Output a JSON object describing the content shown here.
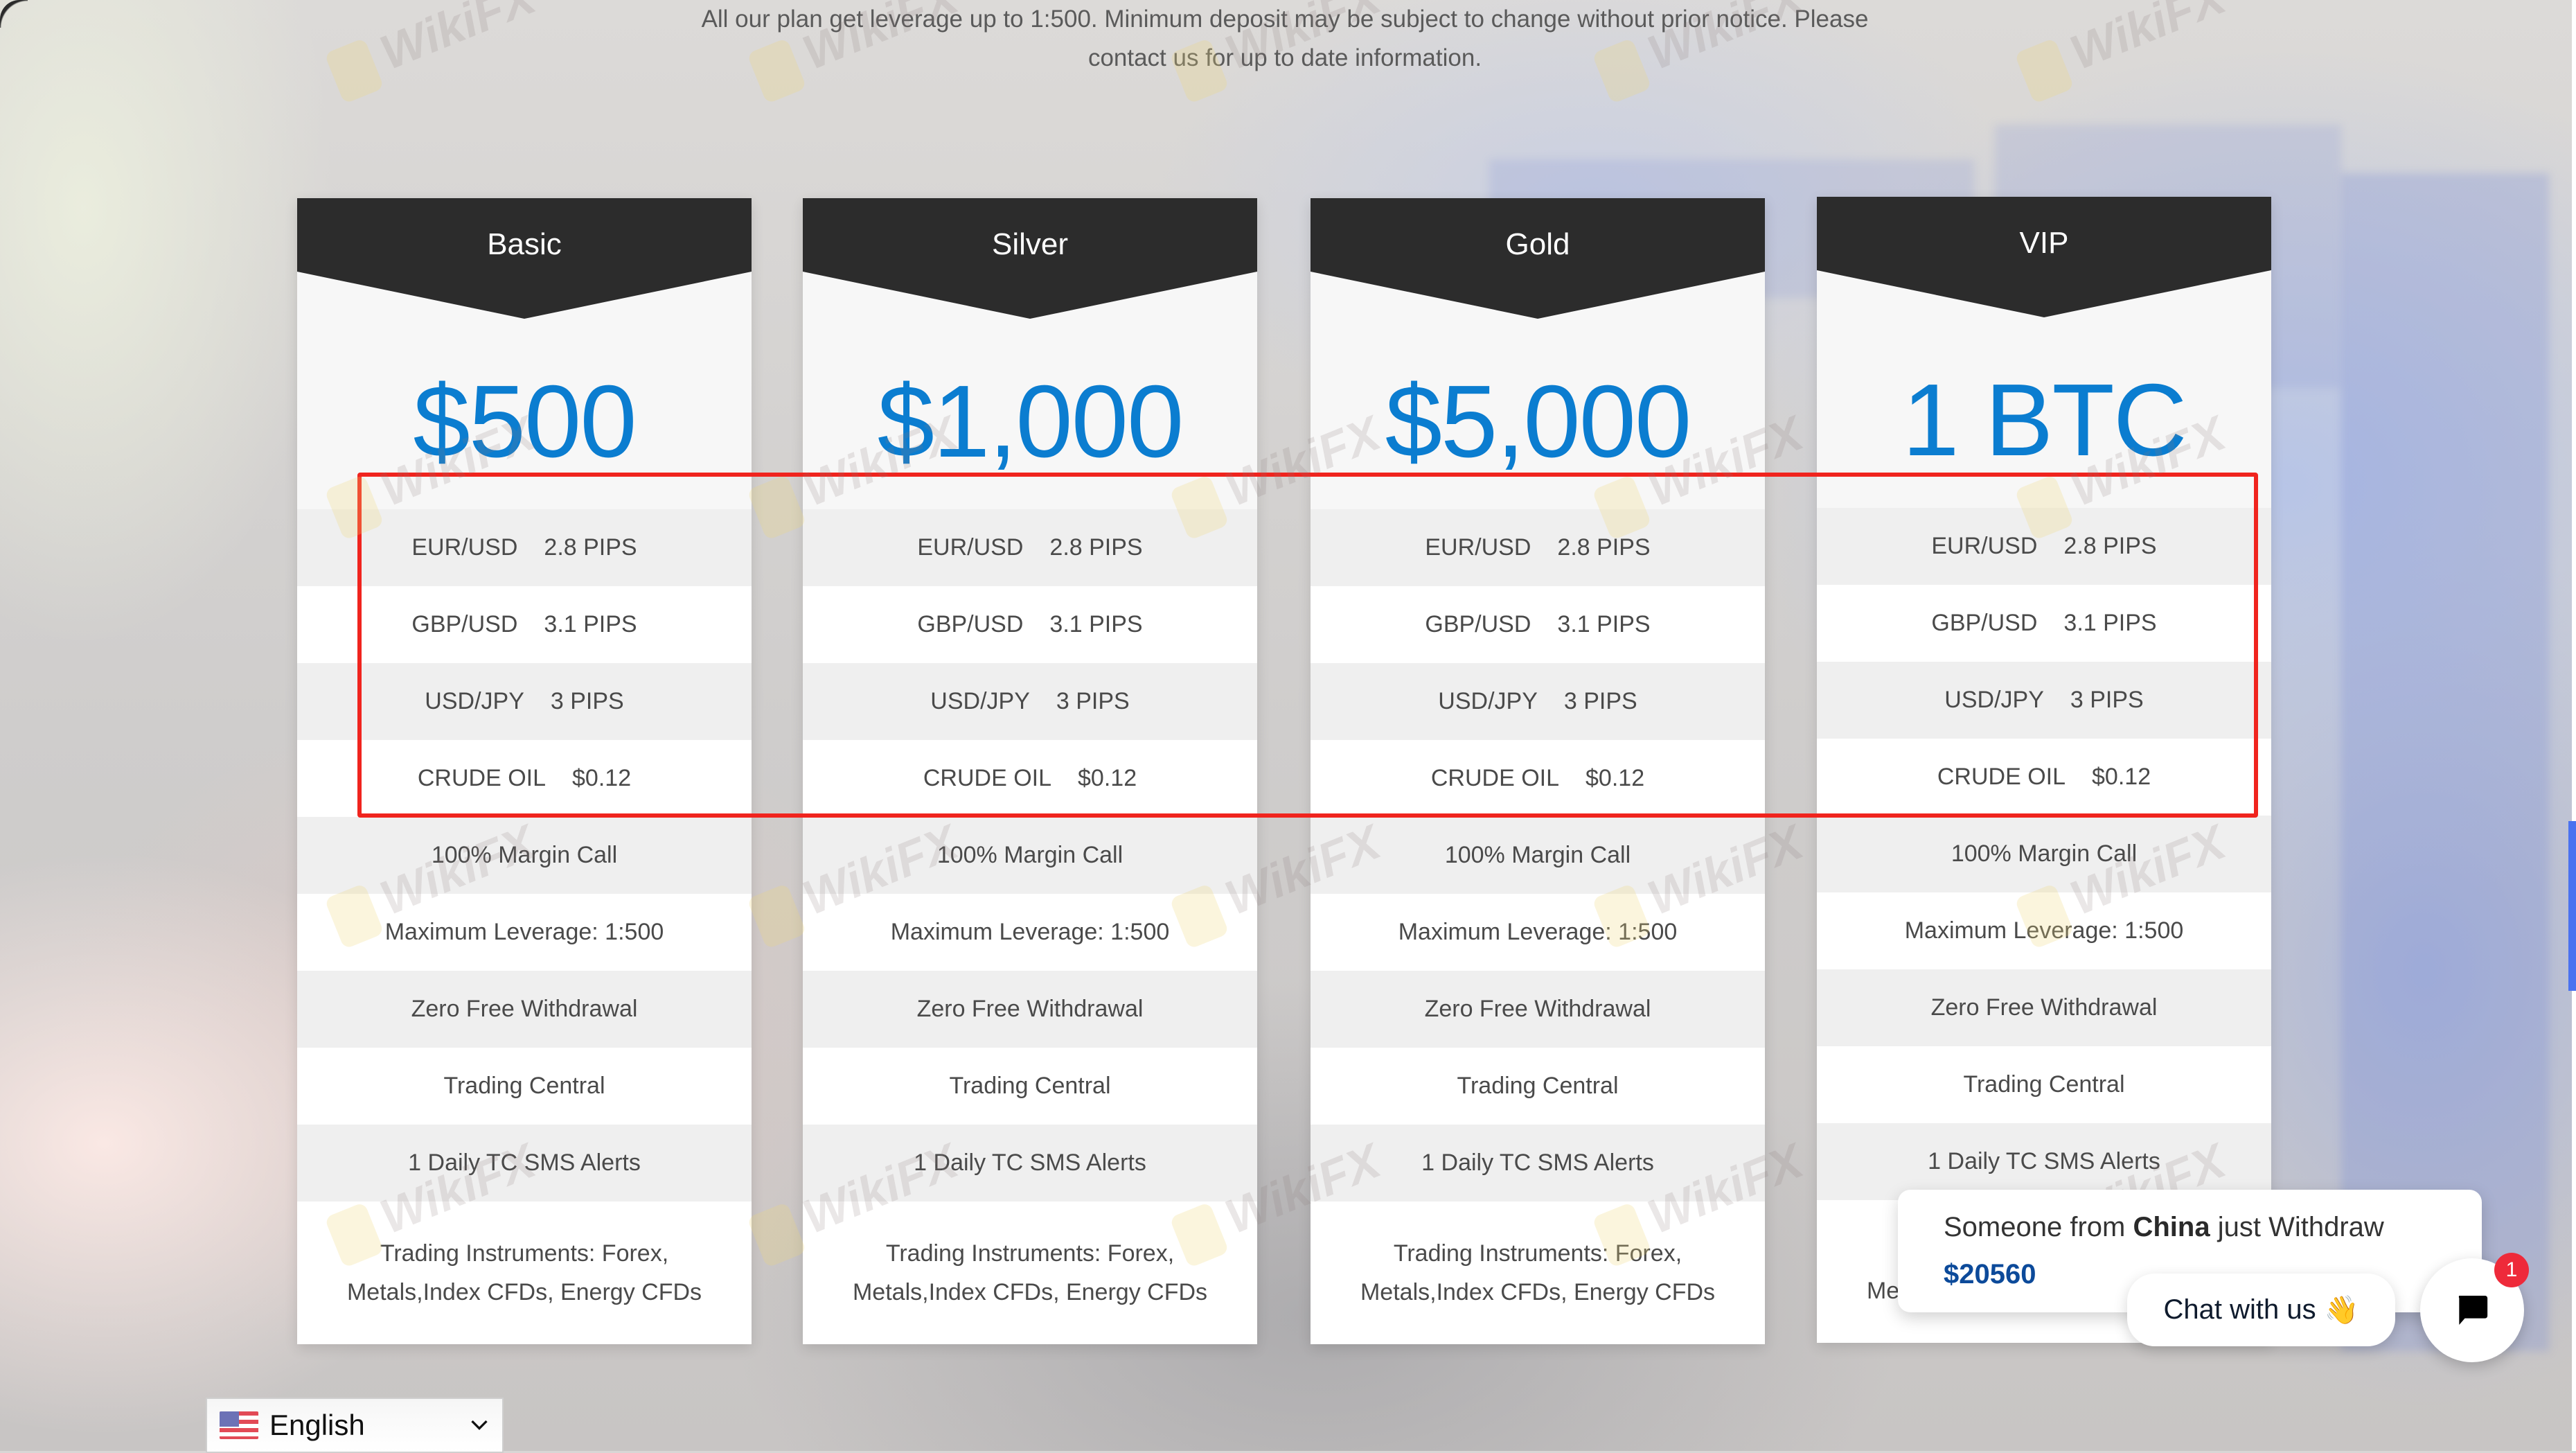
{
  "notice": {
    "line1": "All our plan get leverage up to 1:500. Minimum deposit may be subject to change without prior notice. Please",
    "line2": "contact us for up to date information."
  },
  "colors": {
    "header_dark": "#2c2c2c",
    "price_blue": "#0b7dd0",
    "highlight_red": "#f0241e",
    "scroll_accent": "#4a72f0",
    "badge_red": "#ee2a3a",
    "amount_blue": "#0c4a9a"
  },
  "plans": [
    {
      "name": "Basic",
      "price": "$500",
      "spreads": [
        {
          "pair": "EUR/USD",
          "value": "2.8 PIPS"
        },
        {
          "pair": "GBP/USD",
          "value": "3.1 PIPS"
        },
        {
          "pair": "USD/JPY",
          "value": "3 PIPS"
        },
        {
          "pair": "CRUDE OIL",
          "value": "$0.12"
        }
      ],
      "features": [
        "100% Margin Call",
        "Maximum Leverage: 1:500",
        "Zero Free Withdrawal",
        "Trading Central",
        "1 Daily TC SMS Alerts"
      ],
      "instruments": "Trading Instruments: Forex, Metals,Index CFDs, Energy CFDs"
    },
    {
      "name": "Silver",
      "price": "$1,000",
      "spreads": [
        {
          "pair": "EUR/USD",
          "value": "2.8 PIPS"
        },
        {
          "pair": "GBP/USD",
          "value": "3.1 PIPS"
        },
        {
          "pair": "USD/JPY",
          "value": "3 PIPS"
        },
        {
          "pair": "CRUDE OIL",
          "value": "$0.12"
        }
      ],
      "features": [
        "100% Margin Call",
        "Maximum Leverage: 1:500",
        "Zero Free Withdrawal",
        "Trading Central",
        "1 Daily TC SMS Alerts"
      ],
      "instruments": "Trading Instruments: Forex, Metals,Index CFDs, Energy CFDs"
    },
    {
      "name": "Gold",
      "price": "$5,000",
      "spreads": [
        {
          "pair": "EUR/USD",
          "value": "2.8 PIPS"
        },
        {
          "pair": "GBP/USD",
          "value": "3.1 PIPS"
        },
        {
          "pair": "USD/JPY",
          "value": "3 PIPS"
        },
        {
          "pair": "CRUDE OIL",
          "value": "$0.12"
        }
      ],
      "features": [
        "100% Margin Call",
        "Maximum Leverage: 1:500",
        "Zero Free Withdrawal",
        "Trading Central",
        "1 Daily TC SMS Alerts"
      ],
      "instruments": "Trading Instruments: Forex, Metals,Index CFDs, Energy CFDs"
    },
    {
      "name": "VIP",
      "price": "1 BTC",
      "spreads": [
        {
          "pair": "EUR/USD",
          "value": "2.8 PIPS"
        },
        {
          "pair": "GBP/USD",
          "value": "3.1 PIPS"
        },
        {
          "pair": "USD/JPY",
          "value": "3 PIPS"
        },
        {
          "pair": "CRUDE OIL",
          "value": "$0.12"
        }
      ],
      "features": [
        "100% Margin Call",
        "Maximum Leverage: 1:500",
        "Zero Free Withdrawal",
        "Trading Central",
        "1 Daily TC SMS Alerts"
      ],
      "instruments": "Trading Instruments: Forex, Metals,Index CFDs, Energy CFDs"
    }
  ],
  "watermark": "WikiFX",
  "language": {
    "selected": "English",
    "flag_icon": "us-flag-icon",
    "chevron_icon": "chevron-down-icon"
  },
  "notification": {
    "prefix": "Someone from",
    "country": "China",
    "suffix": "just Withdraw",
    "amount": "$20560"
  },
  "chat": {
    "label": "Chat with us",
    "emoji": "👋",
    "badge_count": "1",
    "icon": "chat-bubble-icon"
  }
}
